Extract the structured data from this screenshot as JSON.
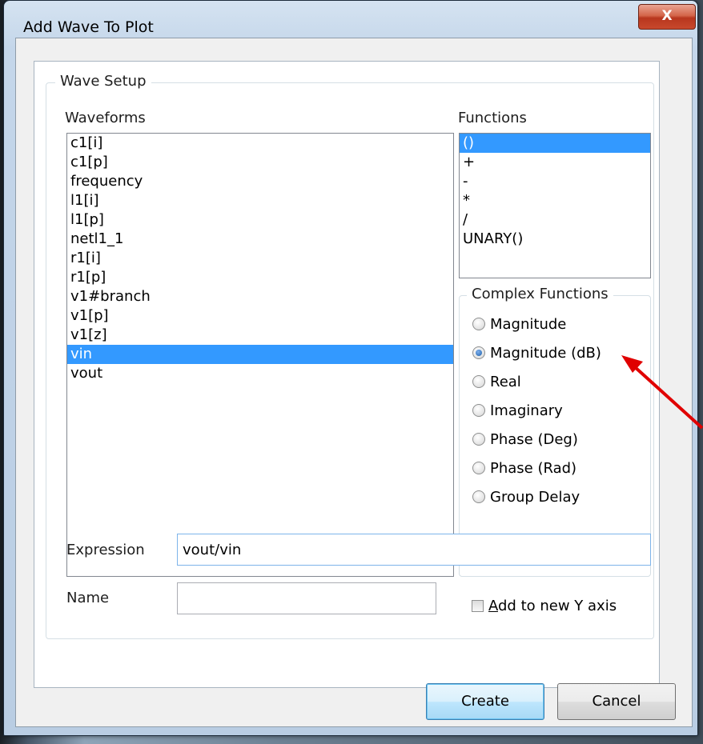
{
  "window": {
    "title": "Add Wave To Plot",
    "close_glyph": "X"
  },
  "wave_setup": {
    "legend": "Wave Setup",
    "waveforms": {
      "label": "Waveforms",
      "items": [
        "c1[i]",
        "c1[p]",
        "frequency",
        "l1[i]",
        "l1[p]",
        "netl1_1",
        "r1[i]",
        "r1[p]",
        "v1#branch",
        "v1[p]",
        "v1[z]",
        "vin",
        "vout"
      ],
      "selected": "vin"
    },
    "functions": {
      "label": "Functions",
      "items": [
        "()",
        "+",
        "-",
        "*",
        "/",
        "UNARY()"
      ],
      "selected": "()"
    },
    "complex_functions": {
      "legend": "Complex Functions",
      "options": [
        "Magnitude",
        "Magnitude (dB)",
        "Real",
        "Imaginary",
        "Phase (Deg)",
        "Phase (Rad)",
        "Group Delay"
      ],
      "selected": "Magnitude (dB)"
    },
    "expression": {
      "label": "Expression",
      "value": "vout/vin"
    },
    "name": {
      "label": "Name",
      "value": ""
    },
    "add_to_new_y_axis": {
      "accel": "A",
      "label_rest": "dd to new Y axis",
      "checked": false
    }
  },
  "buttons": {
    "create": "Create",
    "cancel": "Cancel"
  },
  "colors": {
    "selection": "#3399ff",
    "annotation_arrow": "#e00000"
  }
}
